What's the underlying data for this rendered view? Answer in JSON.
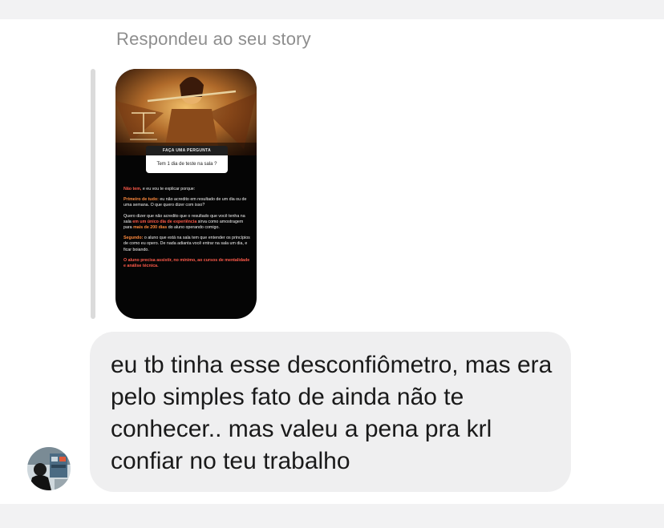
{
  "thread": {
    "reply_caption": "Respondeu ao seu story"
  },
  "story": {
    "question_header": "FAÇA UMA PERGUNTA",
    "question": "Tem 1 dia de teste na sala ?",
    "answer_intro_highlight": "Não tem,",
    "answer_intro_rest": "e eu vou te explicar porque:",
    "first_lead": "Primeiro de tudo:",
    "first_text": "eu não acredito em resultado de um dia ou de uma semana. O que quero dizer com isso?",
    "second_text_start": "Quero dizer que não acredito que o resultado que você tenha na sala",
    "second_highlight": "em um único dia de experiência",
    "second_text_mid": "sirva como amostragem para",
    "second_highlight_2": "mais de 200 dias",
    "second_text_end": "do aluno operando comigo.",
    "third_lead": "Segundo:",
    "third_text": "o aluno que está na sala tem que entender os princípios de como eu opero. De nada adianta você entrar na sala um dia, e ficar boiando.",
    "closing": "O aluno precisa assistir, no mínimo, ao cursos de mentalidade e análise técnica."
  },
  "message": {
    "text": "eu tb tinha esse desconfiômetro, mas era pelo simples fato de ainda não te conhecer.. mas valeu a pena pra krl confiar no teu trabalho"
  },
  "colors": {
    "bubble": "#efeff0",
    "caption": "#8e8e8e",
    "quote_bar": "#dbdbdb"
  }
}
